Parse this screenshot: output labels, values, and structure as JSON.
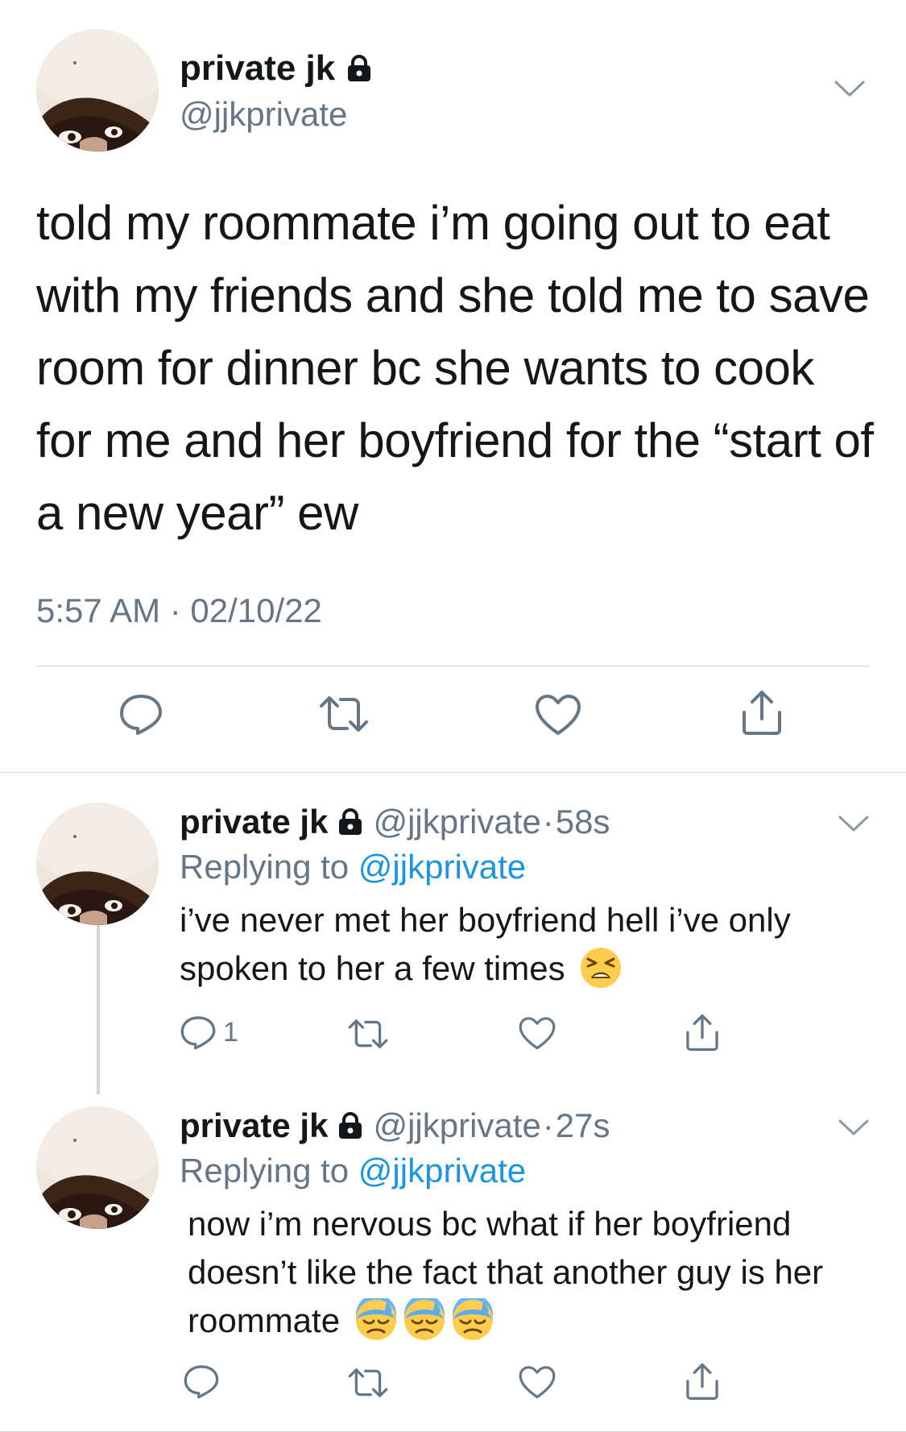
{
  "main_tweet": {
    "name": "private jk",
    "handle": "@jjkprivate",
    "text": "told my roommate i’m going out to eat with my friends and she told me to save room for dinner bc she wants to cook for me and her boyfriend for the “start of a new year” ew",
    "timestamp": "5:57 AM · 02/10/22",
    "icons": [
      "lock-icon",
      "chevron-down-icon",
      "reply-icon",
      "retweet-icon",
      "like-icon",
      "share-icon"
    ]
  },
  "replies": [
    {
      "name": "private jk",
      "handle": "@jjkprivate",
      "dot": "·",
      "time": "58s",
      "replying_label": "Replying to",
      "replying_mention": "@jjkprivate",
      "text": "i’ve never met her boyfriend hell i’ve only spoken to her a few times",
      "emoji": [
        "tired-face-emoji"
      ],
      "reply_count": "1"
    },
    {
      "name": "private jk",
      "handle": "@jjkprivate",
      "dot": "·",
      "time": "27s",
      "replying_label": "Replying to",
      "replying_mention": "@jjkprivate",
      "text": "now i’m nervous bc what if her boyfriend doesn’t like the fact that another guy is her roommate",
      "emoji": [
        "downcast-sweat-emoji",
        "downcast-sweat-emoji",
        "downcast-sweat-emoji"
      ],
      "reply_count": ""
    }
  ],
  "colors": {
    "text": "#14171a",
    "secondary": "#657786",
    "link": "#1b95e0",
    "divider": "#cfd6dc"
  }
}
